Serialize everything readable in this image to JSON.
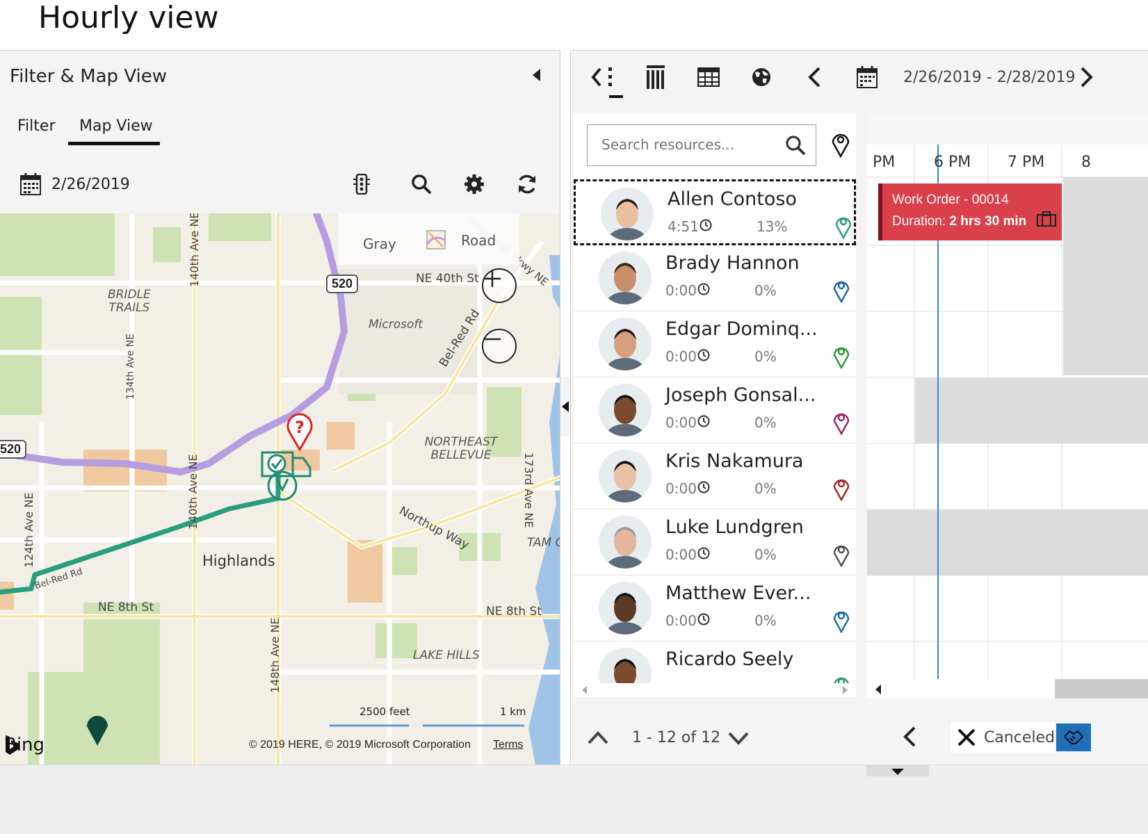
{
  "page": {
    "title": "Hourly view"
  },
  "filter_panel": {
    "title": "Filter & Map View",
    "tabs": [
      {
        "label": "Filter",
        "active": false
      },
      {
        "label": "Map View",
        "active": true
      }
    ],
    "date": "2/26/2019"
  },
  "map": {
    "style_options": [
      "Gray",
      "Road"
    ],
    "labels": {
      "bridle_trails": "BRIDLE TRAILS",
      "microsoft": "Microsoft",
      "ne_40th": "NE 40th St",
      "northeast_bellevue": "NORTHEAST BELLEVUE",
      "highlands": "Highlands",
      "ne_8th_left": "NE 8th St",
      "ne_8th_right": "NE 8th St",
      "lake_hills": "LAKE HILLS",
      "northup_way": "Northup Way",
      "bel_red_top": "Bel-Red Rd",
      "bel_red_bottom": "Bel-Red Rd",
      "tam": "TAM C",
      "ave_140_top": "140th Ave NE",
      "ave_140_mid": "140th Ave NE",
      "ave_134": "134th Ave NE",
      "ave_124": "124th Ave NE",
      "ave_148": "148th Ave NE",
      "ave_173": "173rd Ave NE",
      "sammamish": "mmamish Pkwy NE"
    },
    "route_shields": [
      "520",
      "520"
    ],
    "scale": {
      "feet": "2500 feet",
      "km": "1 km"
    },
    "provider": "Bing",
    "copyright": "© 2019 HERE, © 2019 Microsoft Corporation",
    "terms": "Terms"
  },
  "schedule_board": {
    "date_range": "2/26/2019 - 2/28/2019",
    "search": {
      "placeholder": "Search resources...",
      "value": ""
    },
    "resources": [
      {
        "name": "Allen Contoso",
        "time": "4:51",
        "utilization": "13%",
        "pin_color": "#2a9d7f",
        "selected": true
      },
      {
        "name": "Brady Hannon",
        "time": "0:00",
        "utilization": "0%",
        "pin_color": "#2166ac",
        "selected": false
      },
      {
        "name": "Edgar Dominq...",
        "time": "0:00",
        "utilization": "0%",
        "pin_color": "#2e9b3a",
        "selected": false
      },
      {
        "name": "Joseph Gonsal...",
        "time": "0:00",
        "utilization": "0%",
        "pin_color": "#a0256e",
        "selected": false
      },
      {
        "name": "Kris Nakamura",
        "time": "0:00",
        "utilization": "0%",
        "pin_color": "#a52a2a",
        "selected": false
      },
      {
        "name": "Luke Lundgren",
        "time": "0:00",
        "utilization": "0%",
        "pin_color": "#555555",
        "selected": false
      },
      {
        "name": "Matthew Ever...",
        "time": "0:00",
        "utilization": "0%",
        "pin_color": "#1f6fb0",
        "selected": false
      },
      {
        "name": "Ricardo Seely",
        "time": "",
        "utilization": "",
        "pin_color": "#2a9d7f",
        "selected": false
      }
    ],
    "hours": [
      "PM",
      "6 PM",
      "7 PM",
      "8"
    ],
    "booking": {
      "title": "Work Order - 00014",
      "duration_label": "Duration:",
      "duration_value": "2 hrs 30 min",
      "color": "#d9404a"
    },
    "pager": "1 - 12 of 12",
    "status_filter": "Canceled"
  }
}
